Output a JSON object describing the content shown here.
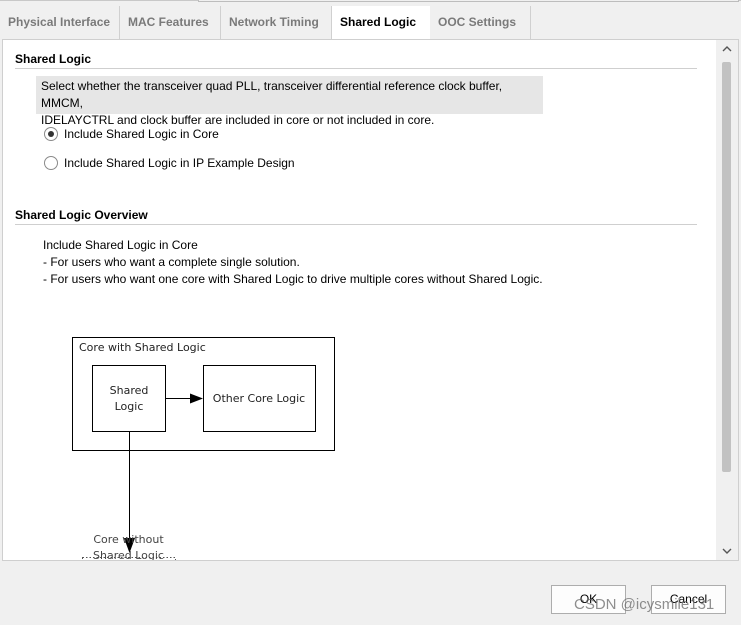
{
  "tabs": [
    {
      "label": "Physical Interface",
      "active": false
    },
    {
      "label": "MAC Features",
      "active": false
    },
    {
      "label": "Network Timing",
      "active": false
    },
    {
      "label": "Shared Logic",
      "active": true
    },
    {
      "label": "OOC Settings",
      "active": false
    }
  ],
  "shared_logic": {
    "title": "Shared Logic",
    "description_line1": "Select whether the transceiver quad PLL, transceiver differential reference clock buffer, MMCM,",
    "description_line2": "IDELAYCTRL and clock buffer are included in core or not included in core.",
    "options": [
      {
        "label": "Include Shared Logic in Core",
        "selected": true
      },
      {
        "label": "Include Shared Logic in IP Example Design",
        "selected": false
      }
    ]
  },
  "overview": {
    "title": "Shared Logic Overview",
    "line1": "Include Shared Logic in Core",
    "line2": "- For users who want a complete single solution.",
    "line3": "- For users who want one core with Shared Logic to drive multiple cores without Shared Logic."
  },
  "diagram": {
    "outer_label": "Core with Shared Logic",
    "shared_line1": "Shared",
    "shared_line2": "Logic",
    "other_core": "Other Core Logic",
    "without_line1": "Core without",
    "without_line2": "Shared Logic"
  },
  "buttons": {
    "ok": "OK",
    "cancel": "Cancel"
  },
  "watermark": "CSDN @icysmile131",
  "icons": {
    "scroll_up": "chevron-up-icon",
    "scroll_down": "chevron-down-icon"
  }
}
